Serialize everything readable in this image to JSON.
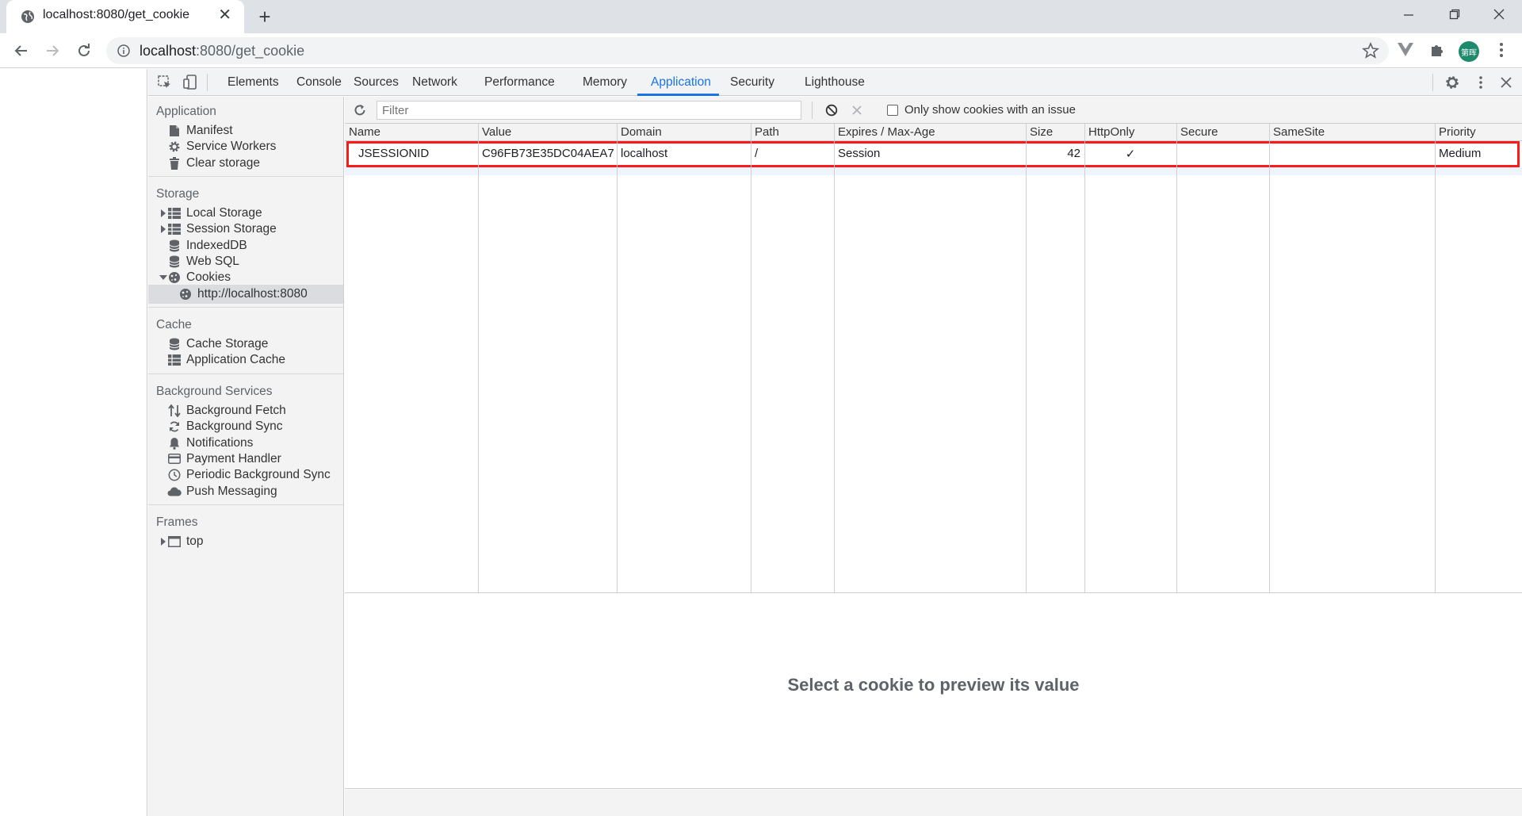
{
  "browser": {
    "tab_title": "localhost:8080/get_cookie",
    "url_host": "localhost",
    "url_rest": ":8080/get_cookie",
    "avatar_text": "第晖"
  },
  "devtools": {
    "tabs": [
      "Elements",
      "Console",
      "Sources",
      "Network",
      "Performance",
      "Memory",
      "Application",
      "Security",
      "Lighthouse"
    ],
    "active_tab": "Application"
  },
  "sidebar": {
    "application": {
      "header": "Application",
      "items": [
        {
          "label": "Manifest",
          "icon": "document-icon"
        },
        {
          "label": "Service Workers",
          "icon": "gear-icon"
        },
        {
          "label": "Clear storage",
          "icon": "trash-icon"
        }
      ]
    },
    "storage": {
      "header": "Storage",
      "items": [
        {
          "label": "Local Storage",
          "icon": "table-icon",
          "expander": "collapsed"
        },
        {
          "label": "Session Storage",
          "icon": "table-icon",
          "expander": "collapsed"
        },
        {
          "label": "IndexedDB",
          "icon": "database-icon"
        },
        {
          "label": "Web SQL",
          "icon": "database-icon"
        },
        {
          "label": "Cookies",
          "icon": "cookie-icon",
          "expander": "expanded"
        },
        {
          "label": "http://localhost:8080",
          "icon": "cookie-icon",
          "selected": true
        }
      ]
    },
    "cache": {
      "header": "Cache",
      "items": [
        {
          "label": "Cache Storage",
          "icon": "database-icon"
        },
        {
          "label": "Application Cache",
          "icon": "table-icon"
        }
      ]
    },
    "background_services": {
      "header": "Background Services",
      "items": [
        {
          "label": "Background Fetch",
          "icon": "arrows-updown-icon"
        },
        {
          "label": "Background Sync",
          "icon": "sync-icon"
        },
        {
          "label": "Notifications",
          "icon": "bell-icon"
        },
        {
          "label": "Payment Handler",
          "icon": "card-icon"
        },
        {
          "label": "Periodic Background Sync",
          "icon": "clock-icon"
        },
        {
          "label": "Push Messaging",
          "icon": "cloud-icon"
        }
      ]
    },
    "frames": {
      "header": "Frames",
      "items": [
        {
          "label": "top",
          "icon": "frame-icon",
          "expander": "collapsed"
        }
      ]
    }
  },
  "cookies": {
    "filter_placeholder": "Filter",
    "only_issues_label": "Only show cookies with an issue",
    "columns": [
      "Name",
      "Value",
      "Domain",
      "Path",
      "Expires / Max-Age",
      "Size",
      "HttpOnly",
      "Secure",
      "SameSite",
      "Priority"
    ],
    "rows": [
      {
        "name": "JSESSIONID",
        "value": "C96FB73E35DC04AEA7...",
        "domain": "localhost",
        "path": "/",
        "expires": "Session",
        "size": "42",
        "httponly": "✓",
        "secure": "",
        "samesite": "",
        "priority": "Medium"
      }
    ],
    "preview_message": "Select a cookie to preview its value"
  },
  "colors": {
    "accent": "#1a73e8",
    "highlight_box": "#ff1a1a",
    "avatar": "#1d8a6e"
  }
}
